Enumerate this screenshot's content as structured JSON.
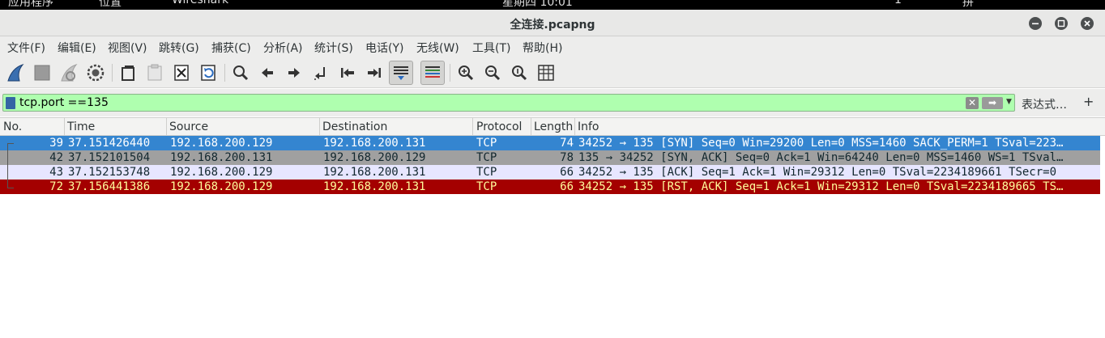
{
  "topbar": {
    "apps": "应用程序",
    "places": "位置",
    "wireshark": "Wireshark",
    "clock": "星期四 10:01",
    "workspace": "1",
    "input": "拼"
  },
  "window": {
    "title": "全连接.pcapng"
  },
  "menu": {
    "items": [
      "文件(F)",
      "编辑(E)",
      "视图(V)",
      "跳转(G)",
      "捕获(C)",
      "分析(A)",
      "统计(S)",
      "电话(Y)",
      "无线(W)",
      "工具(T)",
      "帮助(H)"
    ]
  },
  "toolbar": {
    "icons": [
      "start-capture-icon",
      "stop-capture-icon",
      "restart-capture-icon",
      "capture-options-icon",
      "open-file-icon",
      "save-file-icon",
      "close-file-icon",
      "reload-file-icon",
      "find-packet-icon",
      "go-back-icon",
      "go-forward-icon",
      "go-to-packet-icon",
      "first-packet-icon",
      "last-packet-icon",
      "auto-scroll-icon",
      "colorize-icon",
      "zoom-in-icon",
      "zoom-out-icon",
      "normal-size-icon",
      "resize-columns-icon"
    ]
  },
  "filter": {
    "value": "tcp.port ==135",
    "expression_label": "表达式…",
    "plus_label": "+",
    "bg_color": "#afffaf"
  },
  "packet_list": {
    "columns": [
      "No.",
      "Time",
      "Source",
      "Destination",
      "Protocol",
      "Length",
      "Info"
    ],
    "rows": [
      {
        "no": "39",
        "time": "37.151426440",
        "src": "192.168.200.129",
        "dst": "192.168.200.131",
        "proto": "TCP",
        "len": "74",
        "info": "34252 → 135 [SYN] Seq=0 Win=29200 Len=0 MSS=1460 SACK_PERM=1 TSval=223…",
        "bg": "#3485d0",
        "fg": "#ffffff"
      },
      {
        "no": "42",
        "time": "37.152101504",
        "src": "192.168.200.131",
        "dst": "192.168.200.129",
        "proto": "TCP",
        "len": "78",
        "info": "135 → 34252 [SYN, ACK] Seq=0 Ack=1 Win=64240 Len=0 MSS=1460 WS=1 TSval…",
        "bg": "#a0a0a0",
        "fg": "#12272e"
      },
      {
        "no": "43",
        "time": "37.152153748",
        "src": "192.168.200.129",
        "dst": "192.168.200.131",
        "proto": "TCP",
        "len": "66",
        "info": "34252 → 135 [ACK] Seq=1 Ack=1 Win=29312 Len=0 TSval=2234189661 TSecr=0",
        "bg": "#e7e6ff",
        "fg": "#12272e"
      },
      {
        "no": "72",
        "time": "37.156441386",
        "src": "192.168.200.129",
        "dst": "192.168.200.131",
        "proto": "TCP",
        "len": "66",
        "info": "34252 → 135 [RST, ACK] Seq=1 Ack=1 Win=29312 Len=0 TSval=2234189665 TS…",
        "bg": "#a40000",
        "fg": "#fffc9c"
      }
    ]
  }
}
